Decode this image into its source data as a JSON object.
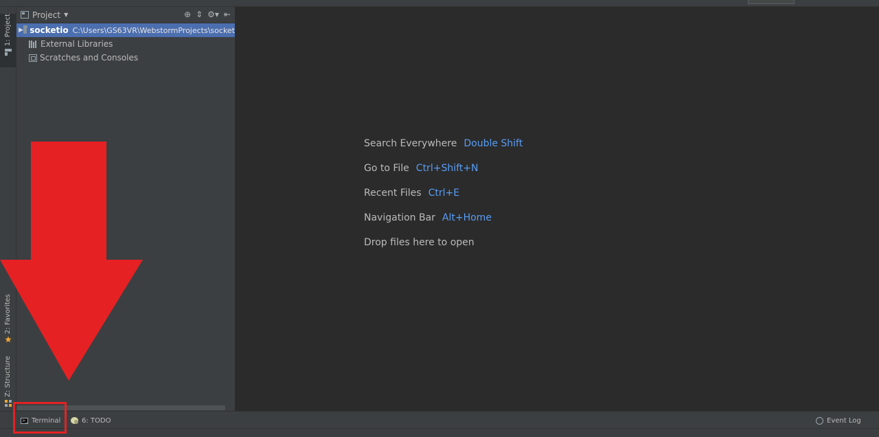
{
  "project_panel": {
    "title": "Project",
    "tree": [
      {
        "name": "socketio",
        "path": "C:\\Users\\GS63VR\\WebstormProjects\\socket"
      },
      {
        "name": "External Libraries"
      },
      {
        "name": "Scratches and Consoles"
      }
    ]
  },
  "left_tabs": {
    "project": "1: Project",
    "favorites": "2: Favorites",
    "structure": "Z: Structure"
  },
  "editor_hints": [
    {
      "label": "Search Everywhere",
      "shortcut": "Double Shift"
    },
    {
      "label": "Go to File",
      "shortcut": "Ctrl+Shift+N"
    },
    {
      "label": "Recent Files",
      "shortcut": "Ctrl+E"
    },
    {
      "label": "Navigation Bar",
      "shortcut": "Alt+Home"
    },
    {
      "label": "Drop files here to open",
      "shortcut": ""
    }
  ],
  "bottom_bar": {
    "terminal": "Terminal",
    "todo": "6: TODO",
    "event_log": "Event Log"
  },
  "colors": {
    "annotation": "#e52124",
    "selection": "#4b6eaf",
    "shortcut": "#589df6"
  },
  "icons": [
    "folder-icon",
    "library-icon",
    "scratches-icon",
    "terminal-icon",
    "todo-icon",
    "event-log-icon",
    "star-icon",
    "settings-gear-icon",
    "locate-icon",
    "collapse-icon",
    "hide-icon"
  ]
}
